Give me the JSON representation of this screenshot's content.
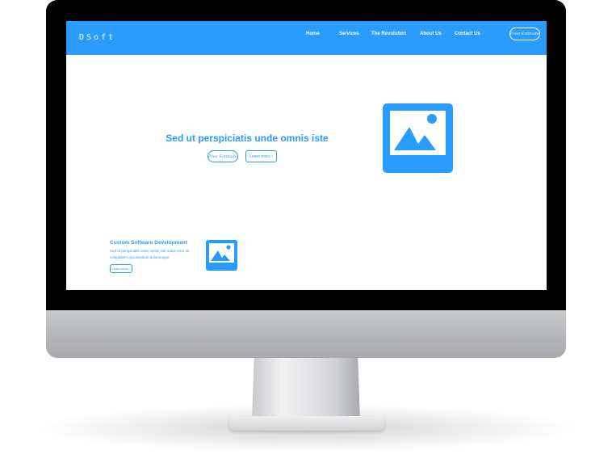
{
  "site": {
    "logo": "DSoft",
    "nav": [
      {
        "label": "Home"
      },
      {
        "label": "Services"
      },
      {
        "label": "The Revolution"
      },
      {
        "label": "About Us"
      },
      {
        "label": "Contact Us"
      }
    ],
    "header_cta": "Free Estimate"
  },
  "hero": {
    "title": "Sed ut perspiciatis unde omnis iste",
    "estimate_button": "Free Estimate",
    "learn_more_button": "Learn more  ›",
    "image_icon": "image-placeholder-icon"
  },
  "service": {
    "title": "Custom Software Development",
    "description": "Sed ut perspiciatis unde omnis iste natus error sit voluptatem accusantium doloremque",
    "learn_more_button": "Learn more  ›",
    "image_icon": "image-placeholder-icon"
  },
  "colors": {
    "accent": "#2a9bff",
    "monitor_bezel": "#000000",
    "monitor_chin": "#b4b5b8"
  }
}
